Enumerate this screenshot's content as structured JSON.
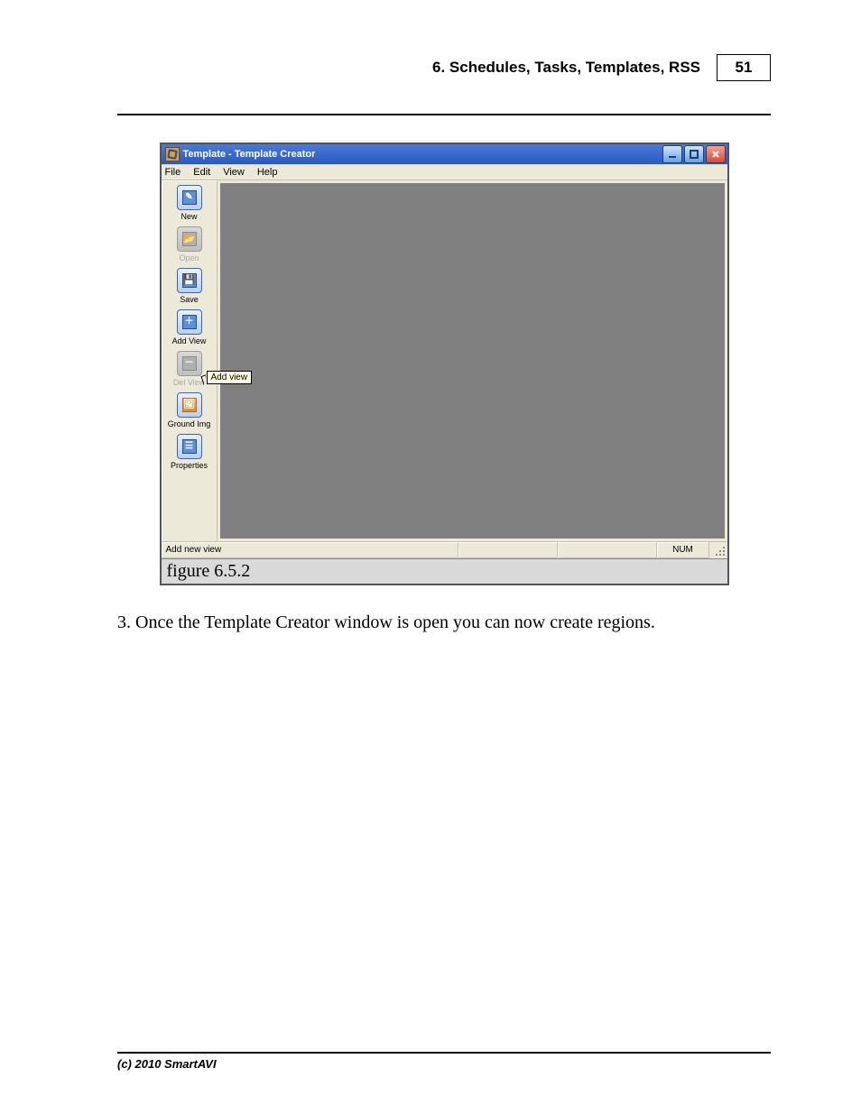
{
  "header": {
    "section_title": "6. Schedules, Tasks, Templates, RSS",
    "page_number": "51"
  },
  "screenshot": {
    "window_title": "Template - Template Creator",
    "menus": [
      "File",
      "Edit",
      "View",
      "Help"
    ],
    "toolbar": {
      "new": {
        "label": "New",
        "enabled": true
      },
      "open": {
        "label": "Open",
        "enabled": false
      },
      "save": {
        "label": "Save",
        "enabled": true
      },
      "add_view": {
        "label": "Add View",
        "enabled": true
      },
      "del_view": {
        "label": "Del View",
        "enabled": false
      },
      "ground_img": {
        "label": "Ground Img",
        "enabled": true
      },
      "properties": {
        "label": "Properties",
        "enabled": true
      }
    },
    "tooltip_text": "Add view",
    "statusbar": {
      "message": "Add new view",
      "num_indicator": "NUM"
    }
  },
  "figure_caption": "figure 6.5.2",
  "body": {
    "step3": "3. Once the Template Creator window is open you can now create regions."
  },
  "footer": "(c) 2010 SmartAVI"
}
